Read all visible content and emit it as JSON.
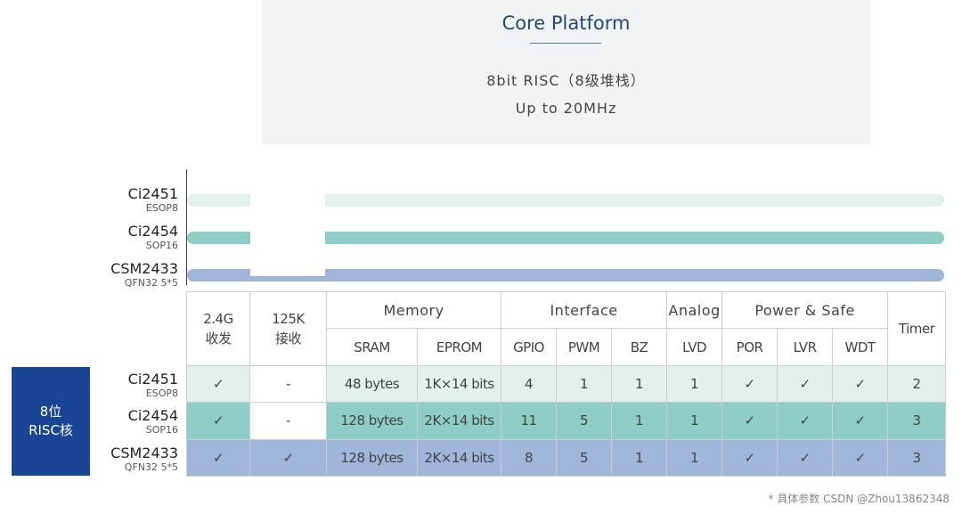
{
  "platform": {
    "title": "Core Platform",
    "line1": "8bit RISC（8级堆栈）",
    "line2": "Up to 20MHz"
  },
  "chips": [
    {
      "name": "Ci2451",
      "package": "ESOP8"
    },
    {
      "name": "Ci2454",
      "package": "SOP16"
    },
    {
      "name": "CSM2433",
      "package": "QFN32 5*5"
    }
  ],
  "badge": {
    "line1": "8位",
    "line2": "RISC核"
  },
  "table": {
    "headers": {
      "rf24": "2.4G\n收发",
      "rf125": "125K\n接收",
      "memory": "Memory",
      "interface": "Interface",
      "analog": "Analog",
      "power": "Power & Safe",
      "timer": "Timer",
      "sram": "SRAM",
      "eprom": "EPROM",
      "gpio": "GPIO",
      "pwm": "PWM",
      "bz": "BZ",
      "lvd": "LVD",
      "por": "POR",
      "lvr": "LVR",
      "wdt": "WDT"
    },
    "rows": [
      {
        "rf24": "✓",
        "rf125": "-",
        "sram": "48 bytes",
        "eprom": "1K×14 bits",
        "gpio": "4",
        "pwm": "1",
        "bz": "1",
        "lvd": "1",
        "por": "✓",
        "lvr": "✓",
        "wdt": "✓",
        "timer": "2"
      },
      {
        "rf24": "✓",
        "rf125": "-",
        "sram": "128 bytes",
        "eprom": "2K×14 bits",
        "gpio": "11",
        "pwm": "5",
        "bz": "1",
        "lvd": "1",
        "por": "✓",
        "lvr": "✓",
        "wdt": "✓",
        "timer": "3"
      },
      {
        "rf24": "✓",
        "rf125": "✓",
        "sram": "128 bytes",
        "eprom": "2K×14 bits",
        "gpio": "8",
        "pwm": "5",
        "bz": "1",
        "lvd": "1",
        "por": "✓",
        "lvr": "✓",
        "wdt": "✓",
        "timer": "3"
      }
    ]
  },
  "footnote": "* 具体参数 CSDN @Zhou13862348"
}
